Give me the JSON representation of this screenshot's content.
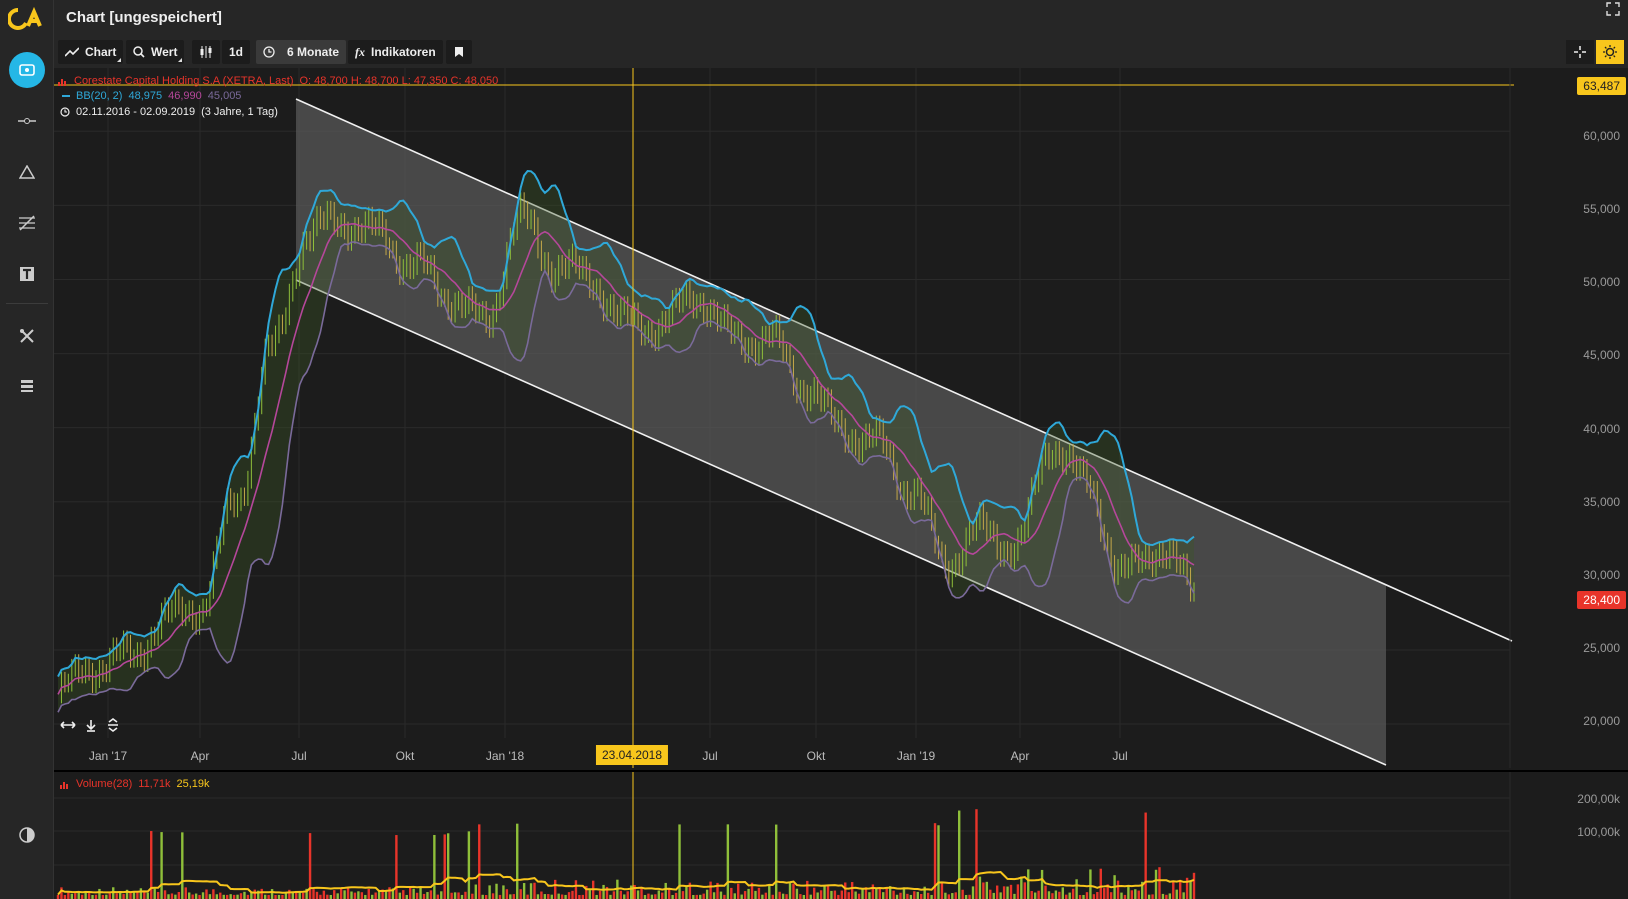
{
  "window": {
    "title": "Chart [ungespeichert]"
  },
  "toolbar": {
    "chart_label": "Chart",
    "wert_label": "Wert",
    "interval_label": "1d",
    "range_label": "6 Monate",
    "indicators_label": "Indikatoren"
  },
  "legend": {
    "instrument": "Corestate Capital Holding S.A (XETRA, Last)",
    "ohlc": "O: 48,700  H: 48,700  L: 47,350  C: 48,050",
    "bb_name": "BB(20, 2)",
    "bb_upper": "48,975",
    "bb_mid": "46,990",
    "bb_lower": "45,005",
    "period": "02.11.2016 - 02.09.2019",
    "period_detail": "(3 Jahre, 1 Tag)"
  },
  "price_labels": {
    "crosshair": "63,487",
    "last": "28,400"
  },
  "crosshair_date": "23.04.2018",
  "volume_legend": {
    "name": "Volume(28)",
    "value1": "11,71k",
    "value2": "25,19k"
  },
  "colors": {
    "accent": "#25b7e6",
    "yellow": "#f8c61c",
    "red": "#e8342a",
    "green": "#8fbf3a",
    "bb_upper": "#2fa8d8",
    "bb_mid": "#b5479a",
    "bb_lower": "#7a6a9a"
  },
  "icons": {
    "sidebar": [
      "chart-icon",
      "line-tool-icon",
      "triangle-icon",
      "fibonacci-icon",
      "text-icon",
      "tools-icon",
      "layout-icon",
      "contrast-icon"
    ]
  },
  "chart_data": [
    {
      "type": "candlestick",
      "title": "Corestate Capital Holding S.A (XETRA, Last)",
      "x_tick_labels": [
        "Jan '17",
        "Apr",
        "Jul",
        "Okt",
        "Jan '18",
        "Jul",
        "Okt",
        "Jan '19",
        "Apr",
        "Jul"
      ],
      "y_tick_labels": [
        "60,000",
        "55,000",
        "50,000",
        "45,000",
        "40,000",
        "35,000",
        "30,000",
        "25,000",
        "20,000"
      ],
      "ylim": [
        17,
        64
      ],
      "x": [
        "2016-11",
        "2017-01",
        "2017-02",
        "2017-03",
        "2017-04",
        "2017-05",
        "2017-06",
        "2017-07",
        "2017-08",
        "2017-09",
        "2017-10",
        "2017-11",
        "2017-12",
        "2018-01",
        "2018-02",
        "2018-03",
        "2018-04",
        "2018-05",
        "2018-06",
        "2018-07",
        "2018-08",
        "2018-09",
        "2018-10",
        "2018-11",
        "2018-12",
        "2019-01",
        "2019-02",
        "2019-03",
        "2019-04",
        "2019-05",
        "2019-06",
        "2019-07",
        "2019-08"
      ],
      "series": [
        {
          "name": "BB(20, 2)",
          "values": [
            22,
            24,
            24.5,
            27,
            28,
            35,
            45,
            53,
            54,
            53,
            51,
            49,
            47,
            54,
            51,
            50,
            47,
            47,
            49,
            46,
            46,
            43,
            40,
            39,
            36,
            31,
            33,
            32,
            39,
            36,
            30,
            32,
            29
          ]
        }
      ],
      "channel": {
        "upper": [
          [
            " 2017-06",
            63
          ],
          [
            "2019-10",
            29.5
          ]
        ],
        "lower": [
          [
            "2017-06",
            50
          ],
          [
            "2019-10",
            17
          ]
        ]
      }
    },
    {
      "type": "bar",
      "title": "Volume(28)",
      "y_tick_labels": [
        "200,00k",
        "100,00k"
      ],
      "ylim": [
        0,
        250
      ]
    }
  ]
}
